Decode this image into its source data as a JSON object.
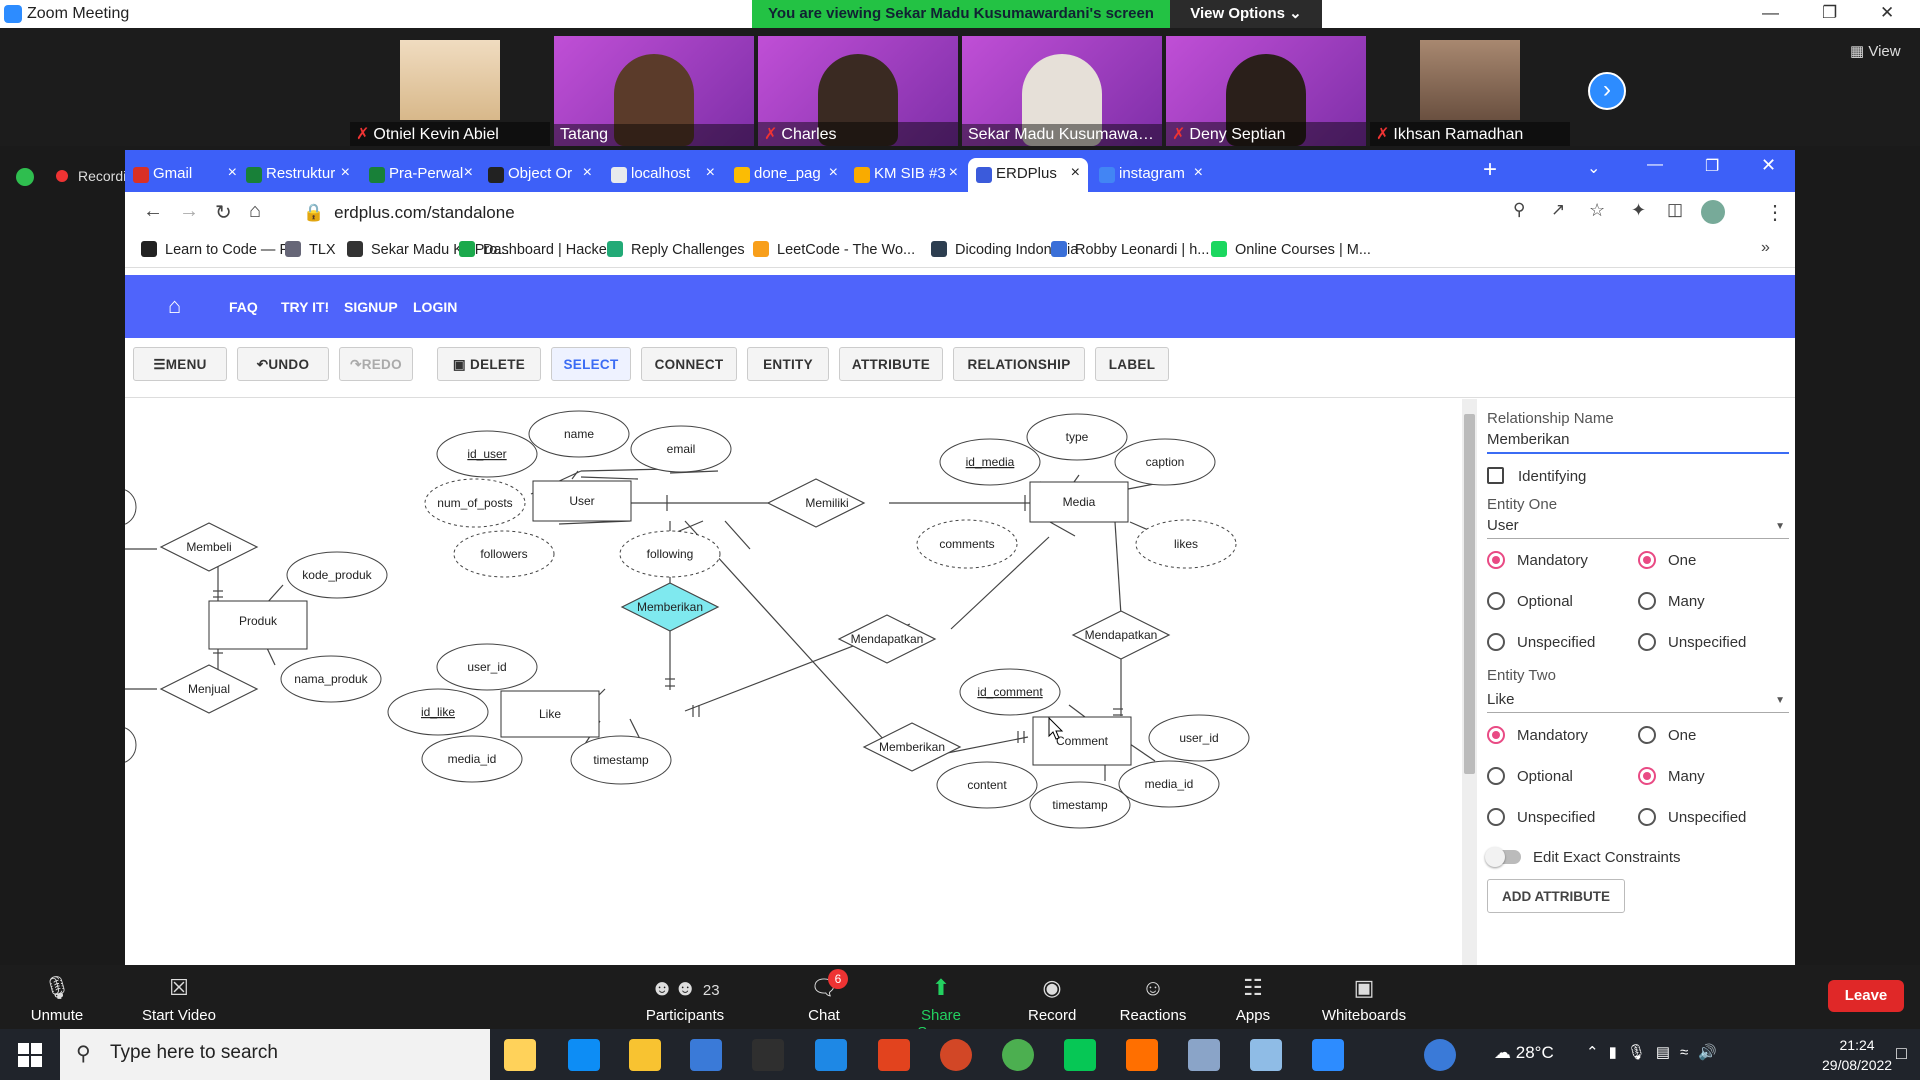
{
  "zoom": {
    "window_title": "Zoom Meeting",
    "banner": "You are viewing Sekar Madu Kusumawardani's screen",
    "view_options": "View Options",
    "view_label": "View",
    "recording": "Recording",
    "participants": [
      {
        "name": "Otniel Kevin Abiel",
        "muted": true
      },
      {
        "name": "Tatang",
        "muted": false
      },
      {
        "name": "Charles",
        "muted": true
      },
      {
        "name": "Sekar Madu Kusumaward...",
        "muted": false
      },
      {
        "name": "Deny Septian",
        "muted": true
      },
      {
        "name": "Ikhsan Ramadhan",
        "muted": true
      }
    ],
    "controls": {
      "unmute": "Unmute",
      "start_video": "Start Video",
      "participants": "Participants",
      "participants_count": "23",
      "chat": "Chat",
      "chat_badge": "6",
      "share_screen": "Share Screen",
      "record": "Record",
      "reactions": "Reactions",
      "apps": "Apps",
      "whiteboards": "Whiteboards",
      "leave": "Leave"
    }
  },
  "browser": {
    "tabs": [
      {
        "label": "Gmail",
        "icon": "gmail-icon",
        "color": "#d93025"
      },
      {
        "label": "Restruktur",
        "icon": "sheets-icon",
        "color": "#188038"
      },
      {
        "label": "Pra-Perwal",
        "icon": "sheets-icon",
        "color": "#188038"
      },
      {
        "label": "Object Or",
        "icon": "generic-icon",
        "color": "#222222"
      },
      {
        "label": "localhost",
        "icon": "page-icon",
        "color": "#e8eaed"
      },
      {
        "label": "done_pag",
        "icon": "drive-icon",
        "color": "#fbbc04"
      },
      {
        "label": "KM SIB #3",
        "icon": "classroom-icon",
        "color": "#f9ab00"
      },
      {
        "label": "ERDPlus",
        "icon": "erdplus-icon",
        "color": "#3b5bdb"
      },
      {
        "label": "instagram",
        "icon": "google-icon",
        "color": "#4285f4"
      }
    ],
    "url": "erdplus.com/standalone",
    "bookmarks": [
      {
        "label": "Learn to Code — F...",
        "color": "#222"
      },
      {
        "label": "TLX",
        "color": "#667"
      },
      {
        "label": "Sekar Madu K | Pro...",
        "color": "#333"
      },
      {
        "label": "Dashboard | Hacker...",
        "color": "#1ba94c"
      },
      {
        "label": "Reply Challenges",
        "color": "#2a7"
      },
      {
        "label": "LeetCode - The Wo...",
        "color": "#f89f1b"
      },
      {
        "label": "Dicoding Indonesia",
        "color": "#2d3e50"
      },
      {
        "label": "Robby Leonardi | h...",
        "color": "#3a6fd8"
      },
      {
        "label": "Online Courses | M...",
        "color": "#1bd75f"
      }
    ]
  },
  "erd": {
    "nav": {
      "faq": "FAQ",
      "try": "TRY IT!",
      "signup": "SIGNUP",
      "login": "LOGIN"
    },
    "toolbar": {
      "menu": "MENU",
      "undo": "UNDO",
      "redo": "REDO",
      "delete": "DELETE",
      "select": "SELECT",
      "connect": "CONNECT",
      "entity": "ENTITY",
      "attribute": "ATTRIBUTE",
      "relationship": "RELATIONSHIP",
      "label": "LABEL"
    },
    "panel": {
      "relationship_name_label": "Relationship Name",
      "relationship_name": "Memberikan",
      "identifying": "Identifying",
      "entity_one_label": "Entity One",
      "entity_one": "User",
      "entity_two_label": "Entity Two",
      "entity_two": "Like",
      "mandatory": "Mandatory",
      "optional": "Optional",
      "unspecified": "Unspecified",
      "one": "One",
      "many": "Many",
      "edit_exact": "Edit Exact Constraints",
      "add_attribute": "ADD ATTRIBUTE",
      "entity_one_participation": "Mandatory",
      "entity_one_cardinality": "One",
      "entity_two_participation": "Mandatory",
      "entity_two_cardinality": "Many"
    },
    "diagram": {
      "entities": {
        "user": "User",
        "media": "Media",
        "produk": "Produk",
        "like": "Like",
        "comment": "Comment"
      },
      "relationships": {
        "memiliki": "Memiliki",
        "memberikan_like": "Memberikan",
        "membeli": "Membeli",
        "menjual": "Menjual",
        "mendapatkan_like": "Mendapatkan",
        "mendapatkan_comment": "Mendapatkan",
        "memberikan_comment": "Memberikan"
      },
      "attributes": {
        "id_user": "id_user",
        "name": "name",
        "email": "email",
        "num_of_posts": "num_of_posts",
        "followers": "followers",
        "following": "following",
        "type": "type",
        "id_media": "id_media",
        "caption": "caption",
        "comments": "comments",
        "likes": "likes",
        "kode_produk": "kode_produk",
        "nama_produk": "nama_produk",
        "like_user_id": "user_id",
        "id_like": "id_like",
        "like_media_id": "media_id",
        "like_timestamp": "timestamp",
        "id_comment": "id_comment",
        "comment_user_id": "user_id",
        "content": "content",
        "comment_timestamp": "timestamp",
        "comment_media_id": "media_id"
      }
    }
  },
  "taskbar": {
    "search_placeholder": "Type here to search",
    "weather": "28°C",
    "time": "21:24",
    "date": "29/08/2022"
  }
}
